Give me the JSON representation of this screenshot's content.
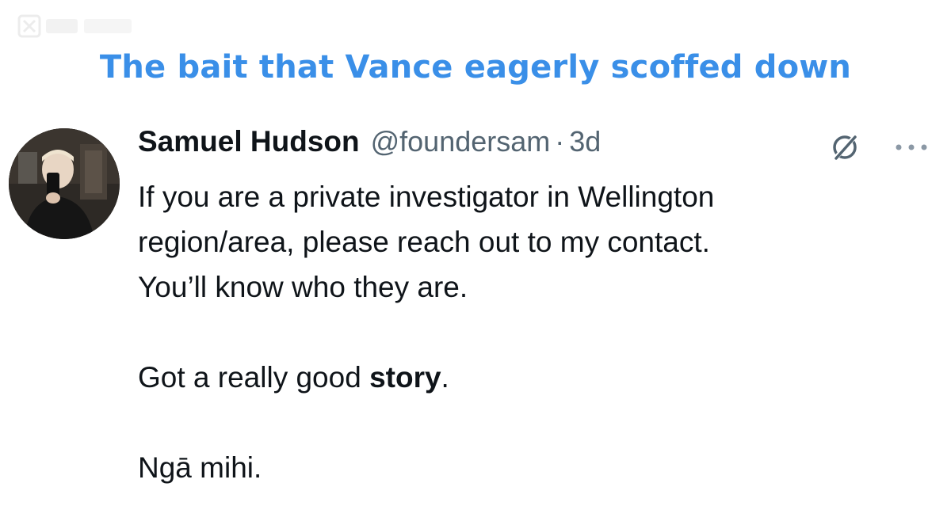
{
  "headline": "The bait that Vance eagerly scoffed down",
  "tweet": {
    "author_name": "Samuel Hudson",
    "author_handle": "@foundersam",
    "separator": "·",
    "timestamp": "3d",
    "body": {
      "line1": "If you are a private investigator in Wellington",
      "line2": "region/area, please reach out to my contact.",
      "line3": "You’ll know who they are.",
      "line4_prefix": "Got a really good ",
      "line4_bold": "story",
      "line4_suffix": ".",
      "line5": "Ngā mihi."
    },
    "icons": {
      "grok": "grok-icon",
      "more": "more-options-icon",
      "avatar": "avatar"
    }
  },
  "colors": {
    "headline": "#3a8fe8",
    "text": "#0f1419",
    "secondary": "#536471"
  }
}
